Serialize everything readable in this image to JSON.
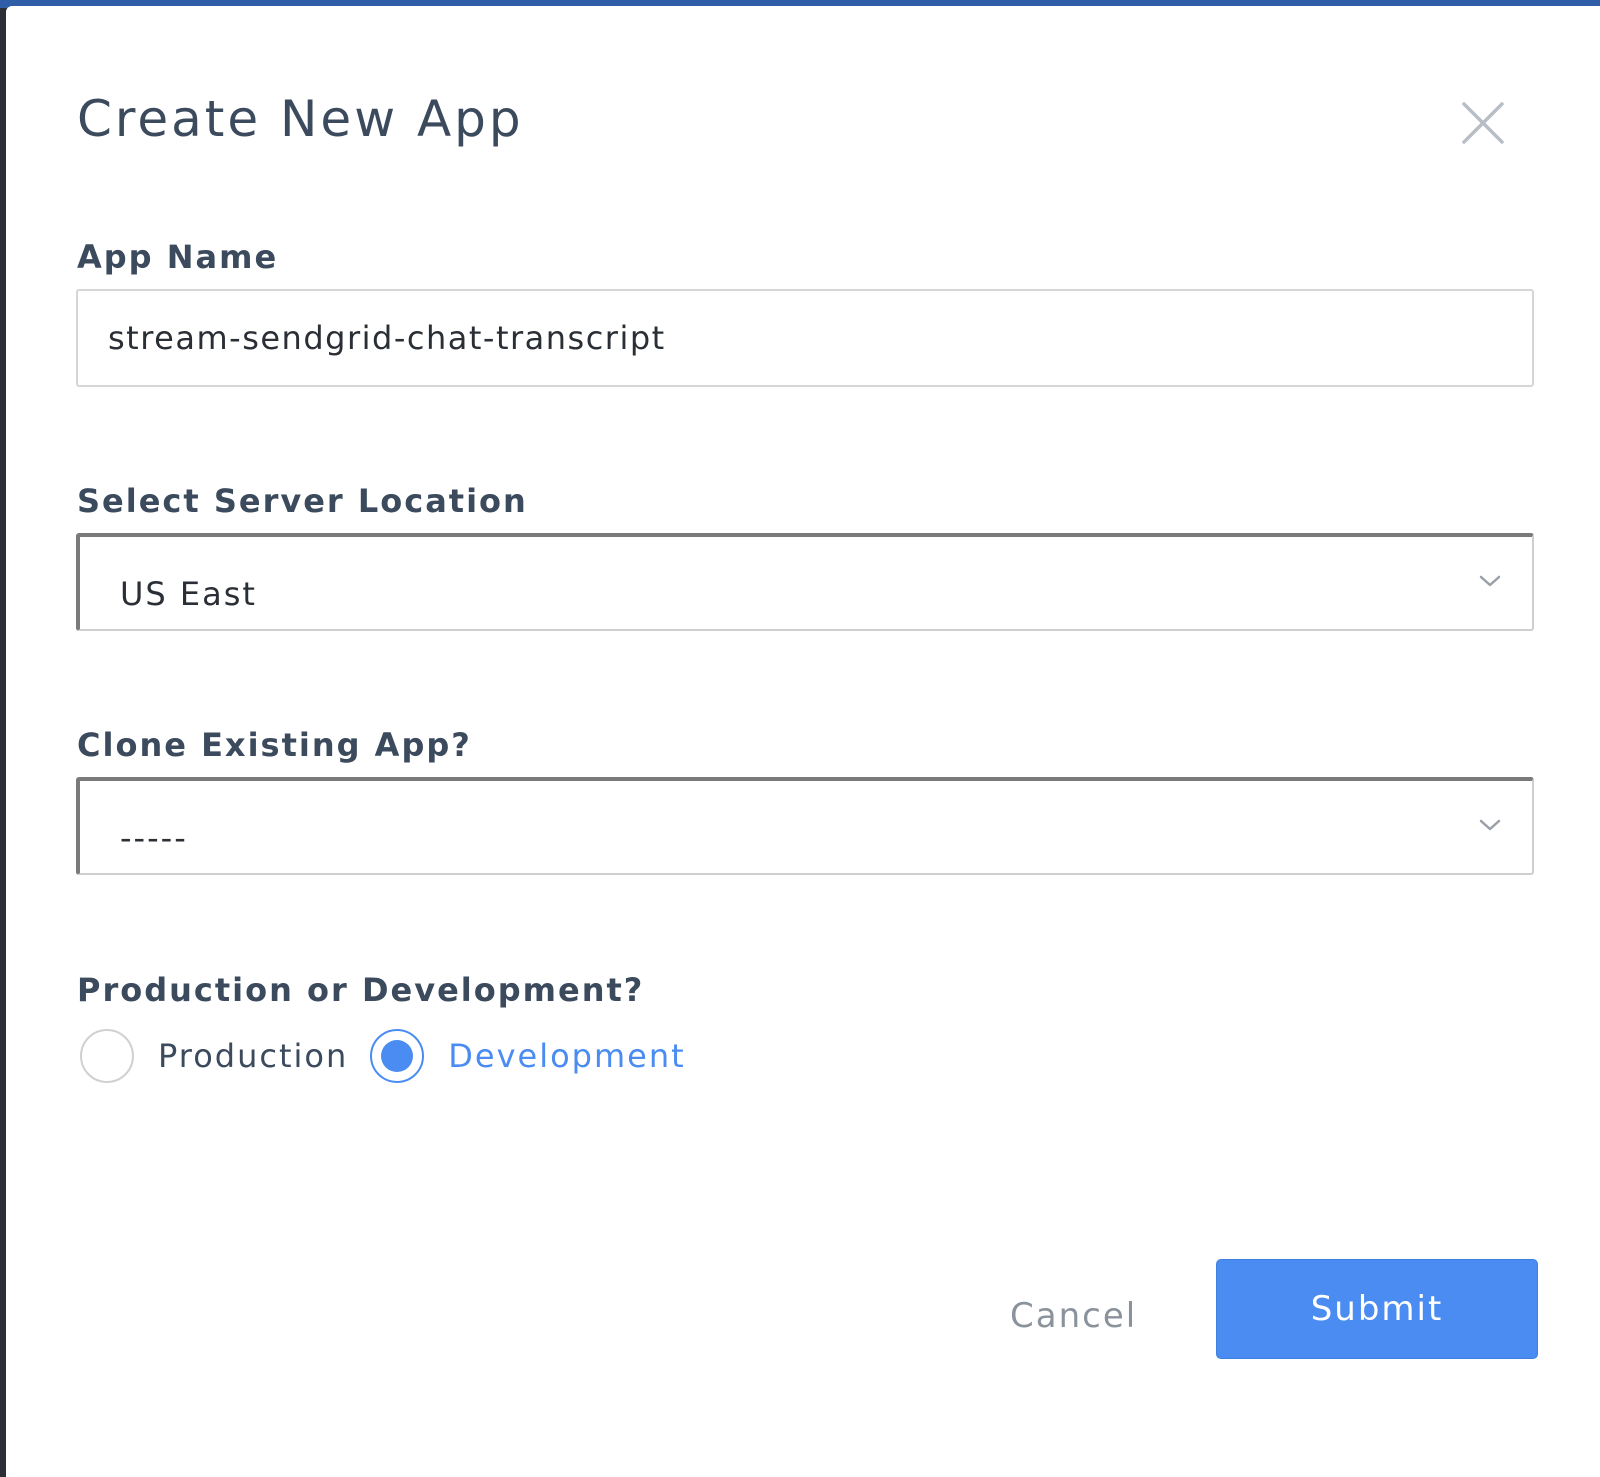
{
  "modal": {
    "title": "Create New App"
  },
  "app_name": {
    "label": "App Name",
    "value": "stream-sendgrid-chat-transcript"
  },
  "server_location": {
    "label": "Select Server Location",
    "selected": "US East"
  },
  "clone_app": {
    "label": "Clone Existing App?",
    "selected": "-----"
  },
  "environment": {
    "label": "Production or Development?",
    "options": [
      {
        "label": "Production",
        "checked": false
      },
      {
        "label": "Development",
        "checked": true
      }
    ]
  },
  "actions": {
    "cancel_label": "Cancel",
    "submit_label": "Submit"
  },
  "colors": {
    "accent": "#4a8cf2",
    "text": "#3b4a5c",
    "muted": "#8a929c"
  },
  "icons": {
    "close": "close-icon",
    "chevron": "chevron-down-icon"
  }
}
